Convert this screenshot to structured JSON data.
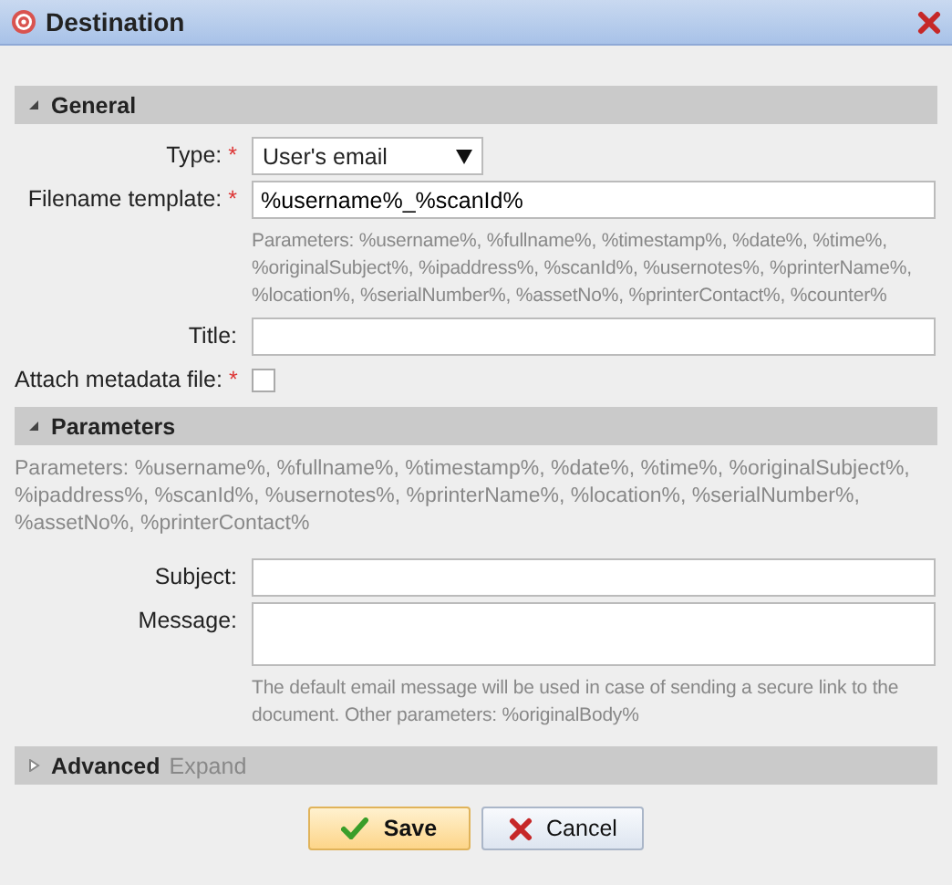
{
  "window": {
    "title": "Destination"
  },
  "required_mark": "*",
  "sections": [
    {
      "title": "General",
      "expanded": true,
      "items": [
        {
          "kind": "select",
          "label": "Type:",
          "required": true,
          "value": "User's email"
        },
        {
          "kind": "text",
          "label": "Filename template:",
          "required": true,
          "value": "%username%_%scanId%"
        },
        {
          "kind": "hint",
          "text": "Parameters: %username%, %fullname%, %timestamp%, %date%, %time%, %originalSubject%, %ipaddress%, %scanId%, %usernotes%, %printerName%, %location%, %serialNumber%, %assetNo%, %printerContact%, %counter%"
        },
        {
          "kind": "text",
          "label": "Title:",
          "required": false,
          "value": ""
        },
        {
          "kind": "checkbox",
          "label": "Attach metadata file:",
          "required": true,
          "checked": false
        }
      ]
    },
    {
      "title": "Parameters",
      "expanded": true,
      "items": [
        {
          "kind": "note",
          "text": "Parameters: %username%, %fullname%, %timestamp%, %date%, %time%, %originalSubject%, %ipaddress%, %scanId%, %usernotes%, %printerName%, %location%, %serialNumber%, %assetNo%, %printerContact%"
        },
        {
          "kind": "text",
          "label": "Subject:",
          "required": false,
          "value": ""
        },
        {
          "kind": "textarea",
          "label": "Message:",
          "required": false,
          "value": ""
        },
        {
          "kind": "hint",
          "text": "The default email message will be used in case of sending a secure link to the document. Other parameters: %originalBody%"
        }
      ]
    },
    {
      "title": "Advanced",
      "expanded": false,
      "action": "Expand"
    }
  ],
  "buttons": [
    {
      "kind": "save",
      "label": "Save"
    },
    {
      "kind": "cancel",
      "label": "Cancel"
    }
  ]
}
